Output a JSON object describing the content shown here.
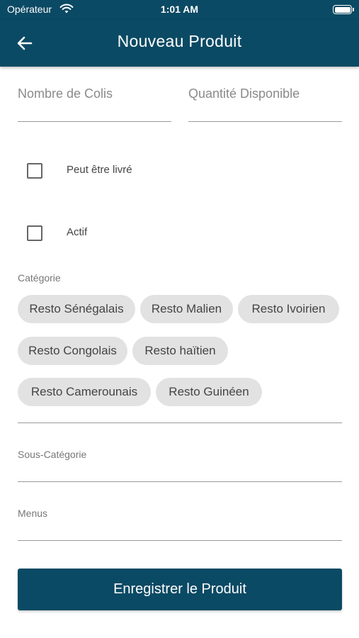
{
  "status_bar": {
    "carrier": "Opérateur",
    "time": "1:01 AM"
  },
  "nav": {
    "title": "Nouveau Produit"
  },
  "fields": {
    "colis_placeholder": "Nombre de Colis",
    "quantite_placeholder": "Quantité Disponible"
  },
  "checkboxes": {
    "livrable_label": "Peut être livré",
    "livrable_checked": false,
    "actif_label": "Actif",
    "actif_checked": false
  },
  "categorie": {
    "label": "Catégorie",
    "chips": [
      "Resto Sénégalais",
      "Resto Malien",
      "Resto Ivoirien",
      "Resto Congolais",
      "Resto haïtien",
      "Resto Camerounais",
      "Resto Guinéen"
    ]
  },
  "sous_categorie": {
    "label": "Sous-Catégorie"
  },
  "menus": {
    "label": "Menus"
  },
  "actions": {
    "save_label": "Enregistrer le Produit"
  },
  "colors": {
    "primary": "#0b4a64",
    "chip_bg": "#e2e2e2"
  }
}
